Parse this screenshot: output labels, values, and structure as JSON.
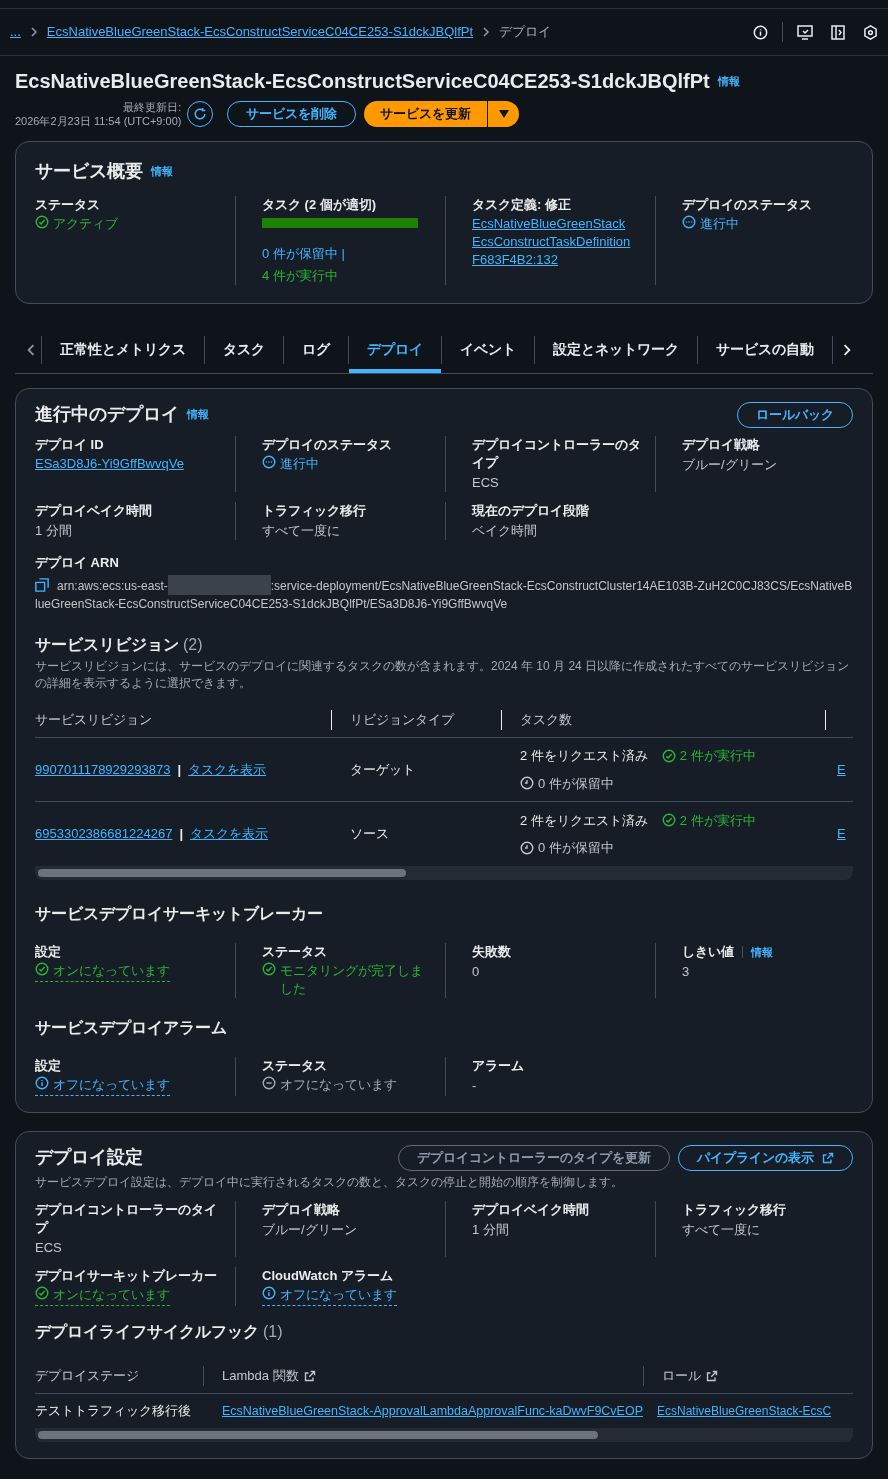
{
  "breadcrumb": [
    {
      "label": "...",
      "link": true
    },
    {
      "label": "EcsNativeBlueGreenStack-EcsConstructServiceC04CE253-S1dckJBQlfPt",
      "link": true
    },
    {
      "label": "デプロイ",
      "link": false
    }
  ],
  "header": {
    "title": "EcsNativeBlueGreenStack-EcsConstructServiceC04CE253-S1dckJBQlfPt",
    "info": "情報",
    "last_updated_label": "最終更新日:",
    "last_updated": "2026年2月23日 11:54 (UTC+9:00)",
    "buttons": [
      {
        "label": "サービスを削除",
        "kind": "outline"
      },
      {
        "label": "サービスを更新",
        "kind": "primary"
      }
    ]
  },
  "overview": {
    "title": "サービス概要",
    "info": "情報",
    "fields": [
      {
        "label": "ステータス",
        "kind": "success",
        "value": "アクティブ",
        "popover": false
      },
      {
        "label": "タスク (2 個が適切)",
        "kind": "tasks",
        "level": 1,
        "lines": [
          {
            "text": "0 件が保留中 |",
            "kind": "pending"
          },
          {
            "text": "4 件が実行中",
            "kind": "running"
          }
        ]
      },
      {
        "label": "タスク定義: 修正",
        "kind": "link",
        "value": "EcsNativeBlueGreenStackEcsConstructTaskDefinitionF683F4B2:132"
      },
      {
        "label": "デプロイのステータス",
        "kind": "progressing",
        "value": "進行中",
        "popover": false
      }
    ]
  },
  "tabs": [
    {
      "label": "正常性とメトリクス",
      "selected": false
    },
    {
      "label": "タスク",
      "selected": false
    },
    {
      "label": "ログ",
      "selected": false
    },
    {
      "label": "デプロイ",
      "selected": true
    },
    {
      "label": "イベント",
      "selected": false
    },
    {
      "label": "設定とネットワーク",
      "selected": false
    },
    {
      "label": "サービスの自動",
      "selected": false
    }
  ],
  "deployment": {
    "title": "進行中のデプロイ",
    "info": "情報",
    "buttons": [
      {
        "label": "ロールバック",
        "disabled": false,
        "external": false
      }
    ],
    "fields": [
      {
        "label": "デプロイ ID",
        "kind": "link",
        "value": "ESa3D8J6-Yi9GffBwvqVe"
      },
      {
        "label": "デプロイのステータス",
        "kind": "progressing",
        "value": "進行中",
        "popover": false
      },
      {
        "label": "デプロイコントローラーのタイプ",
        "kind": "text",
        "value": "ECS"
      },
      {
        "label": "デプロイ戦略",
        "kind": "text",
        "value": "ブルー/グリーン"
      },
      {
        "label": "デプロイベイク時間",
        "kind": "text",
        "value": "1 分間"
      },
      {
        "label": "トラフィック移行",
        "kind": "text",
        "value": "すべて一度に"
      },
      {
        "label": "現在のデプロイ段階",
        "kind": "text",
        "value": "ベイク時間"
      }
    ],
    "arn": {
      "label": "デプロイ ARN",
      "before": "arn:aws:ecs:us-east-",
      "redacted": true,
      "after": ":service-deployment/EcsNativeBlueGreenStack-EcsConstructCluster14AE103B-ZuH2C0CJ83CS/EcsNativeBlueGreenStack-EcsConstructServiceC04CE253-S1dckJBQlfPt/ESa3D8J6-Yi9GffBwvqVe"
    },
    "revisions": {
      "title": "サービスリビジョン",
      "count": "(2)",
      "description": "サービスリビジョンには、サービスのデプロイに関連するタスクの数が含まれます。2024 年 10 月 24 日以降に作成されたすべてのサービスリビジョンの詳細を表示するように選択できます。",
      "columns": [
        "サービスリビジョン",
        "リビジョンタイプ",
        "タスク数"
      ],
      "rows": [
        {
          "revision": "9907011178929293873",
          "separator": "|",
          "tasks_link": "タスクを表示",
          "type": "ターゲット",
          "requested": "2 件をリクエスト済み",
          "running": "2 件が実行中",
          "pending": "0 件が保留中",
          "column_4": "E"
        },
        {
          "revision": "6953302386681224267",
          "separator": "|",
          "tasks_link": "タスクを表示",
          "type": "ソース",
          "requested": "2 件をリクエスト済み",
          "running": "2 件が実行中",
          "pending": "0 件が保留中",
          "column_4": "E"
        }
      ]
    },
    "circuit_breaker": {
      "title": "サービスデプロイサーキットブレーカー",
      "fields": [
        {
          "label": "設定",
          "kind": "success",
          "value": "オンになっています",
          "popover": true
        },
        {
          "label": "ステータス",
          "kind": "success",
          "value": "モニタリングが完了しました",
          "popover": false
        },
        {
          "label": "失敗数",
          "kind": "text",
          "value": "0"
        },
        {
          "label": "しきい値",
          "info": "情報",
          "kind": "text",
          "value": "3"
        }
      ]
    },
    "alarms": {
      "title": "サービスデプロイアラーム",
      "fields": [
        {
          "label": "設定",
          "kind": "info",
          "value": "オフになっています",
          "popover": true
        },
        {
          "label": "ステータス",
          "kind": "stopped",
          "value": "オフになっています",
          "popover": false
        },
        {
          "label": "アラーム",
          "kind": "text",
          "value": "-"
        }
      ]
    }
  },
  "deploy_settings": {
    "title": "デプロイ設定",
    "buttons": [
      {
        "label": "デプロイコントローラーのタイプを更新",
        "disabled": true,
        "external": false
      },
      {
        "label": "パイプラインの表示",
        "disabled": false,
        "external": true
      }
    ],
    "description": "サービスデプロイ設定は、デプロイ中に実行されるタスクの数と、タスクの停止と開始の順序を制御します。",
    "fields": [
      {
        "label": "デプロイコントローラーのタイプ",
        "kind": "text",
        "value": "ECS"
      },
      {
        "label": "デプロイ戦略",
        "kind": "text",
        "value": "ブルー/グリーン"
      },
      {
        "label": "デプロイベイク時間",
        "kind": "text",
        "value": "1 分間"
      },
      {
        "label": "トラフィック移行",
        "kind": "text",
        "value": "すべて一度に"
      },
      {
        "label": "デプロイサーキットブレーカー",
        "kind": "success",
        "value": "オンになっています",
        "popover": true
      },
      {
        "label": "CloudWatch アラーム",
        "kind": "info",
        "value": "オフになっています",
        "popover": true
      }
    ],
    "hooks": {
      "title": "デプロイライフサイクルフック",
      "count": "(1)",
      "columns": [
        {
          "label": "デプロイステージ",
          "external": false
        },
        {
          "label": "Lambda 関数",
          "external": true
        },
        {
          "label": "ロール",
          "external": true
        }
      ],
      "rows": [
        {
          "stage": "テストトラフィック移行後",
          "lambda": "EcsNativeBlueGreenStack-ApprovalLambdaApprovalFunc-kaDwvF9CvEOP",
          "role": "EcsNativeBlueGreenStack-EcsC"
        }
      ]
    }
  }
}
